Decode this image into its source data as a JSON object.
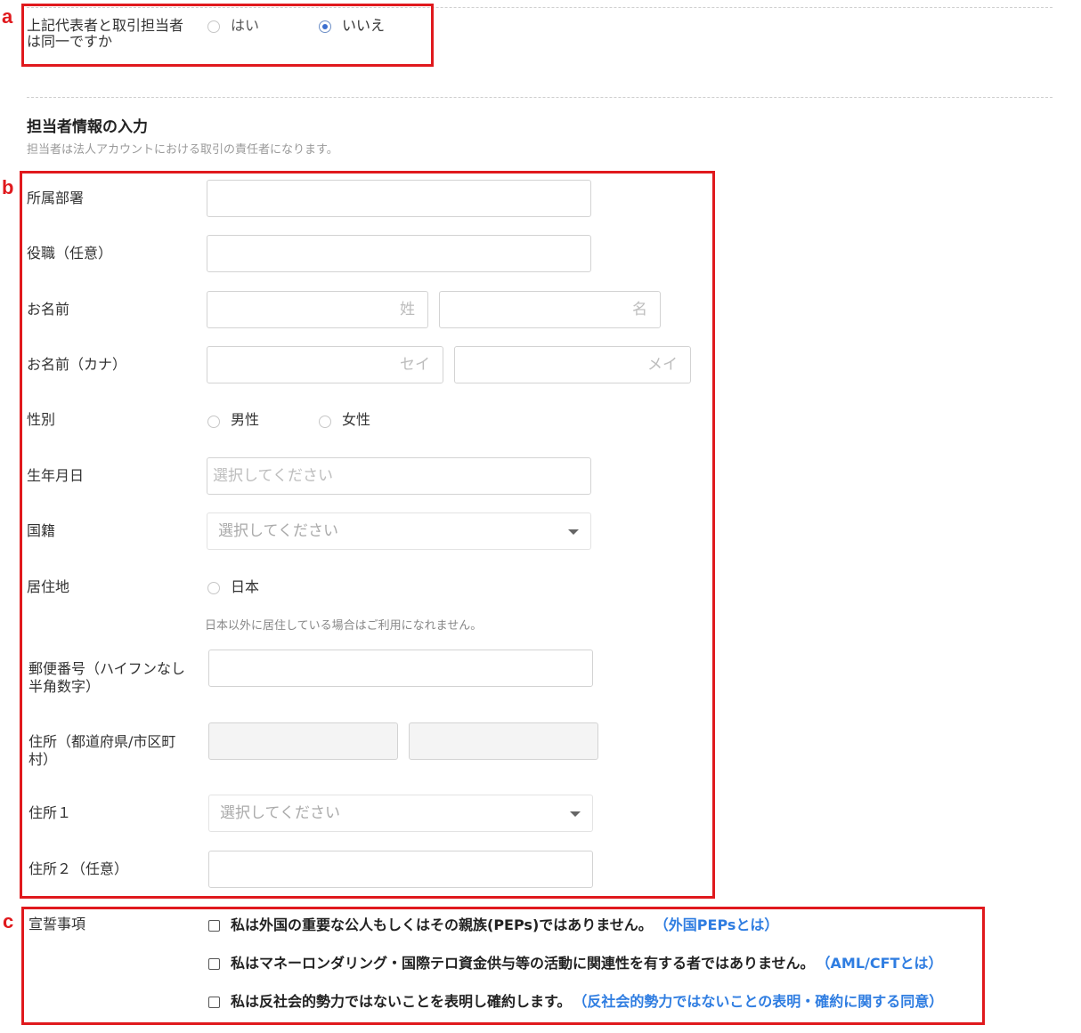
{
  "same_person": {
    "label_line1": "上記代表者と取引担当者",
    "label_line2": "は同一ですか",
    "options": [
      "はい",
      "いいえ"
    ],
    "selected": "いいえ"
  },
  "section": {
    "title": "担当者情報の入力",
    "subtitle": "担当者は法人アカウントにおける取引の責任者になります。"
  },
  "form": {
    "department_label": "所属部署",
    "position_label": "役職（任意）",
    "name_label": "お名前",
    "name_last_placeholder": "姓",
    "name_first_placeholder": "名",
    "kana_label": "お名前（カナ）",
    "kana_last_placeholder": "セイ",
    "kana_first_placeholder": "メイ",
    "gender_label": "性別",
    "gender_options": [
      "男性",
      "女性"
    ],
    "birth_label": "生年月日",
    "birth_placeholder": "選択してください",
    "nationality_label": "国籍",
    "nationality_placeholder": "選択してください",
    "residence_label": "居住地",
    "residence_option": "日本",
    "residence_note": "日本以外に居住している場合はご利用になれません。",
    "postal_label_line1": "郵便番号（ハイフンなし",
    "postal_label_line2": "半角数字）",
    "address_label_line1": "住所（都道府県/市区町",
    "address_label_line2": "村）",
    "address1_label": "住所１",
    "address1_placeholder": "選択してください",
    "address2_label": "住所２（任意）"
  },
  "declarations": {
    "label": "宣誓事項",
    "items": [
      {
        "text": "私は外国の重要な公人もしくはその親族(PEPs)ではありません。",
        "link": "（外国PEPsとは）"
      },
      {
        "text": "私はマネーロンダリング・国際テロ資金供与等の活動に関連性を有する者ではありません。",
        "link": "（AML/CFTとは）"
      },
      {
        "text": "私は反社会的勢力ではないことを表明し確約します。",
        "link": "（反社会的勢力ではないことの表明・確約に関する同意）"
      }
    ]
  },
  "annotations": {
    "a": "a",
    "b": "b",
    "c": "c"
  },
  "colors": {
    "highlight": "#e0191d",
    "link": "#2f7de1",
    "radio_selected": "#3b6fcf"
  }
}
